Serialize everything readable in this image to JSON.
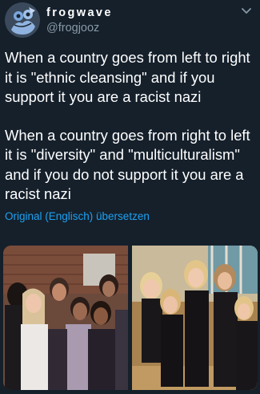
{
  "tweet": {
    "author": {
      "display_name": "frogwave",
      "handle": "@frogjooz",
      "avatar_icon": "frog-avatar-icon"
    },
    "menu_icon": "chevron-down-icon",
    "paragraphs": [
      "When a country goes from left to right it is \"ethnic cleansing\" and if you support it you are a racist nazi",
      "When a country goes from right to left it is \"diversity\" and \"multiculturalism\" and if you do not support it you are a racist nazi"
    ],
    "translate_link": "Original (Englisch) übersetzen",
    "media": {
      "count": 2,
      "images": [
        "group-photo-diverse-schoolgirls",
        "group-photo-dance-team"
      ]
    }
  },
  "colors": {
    "background": "#15202b",
    "text_primary": "#ffffff",
    "text_secondary": "#8899a6",
    "link": "#1da1f2"
  }
}
